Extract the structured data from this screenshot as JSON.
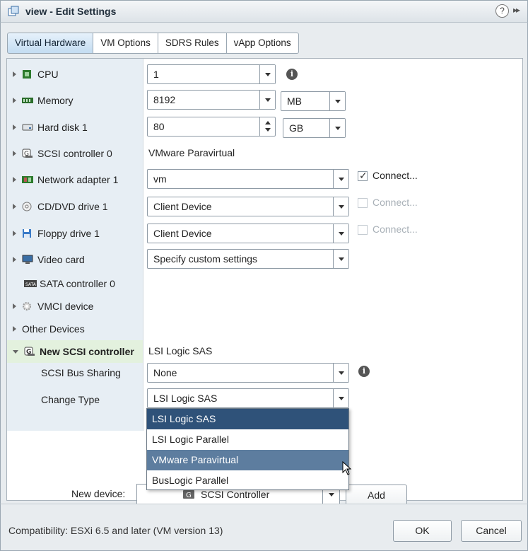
{
  "window": {
    "title": "view - Edit Settings",
    "help": "?",
    "expand": "▸▸"
  },
  "tabs": [
    {
      "label": "Virtual Hardware",
      "active": true
    },
    {
      "label": "VM Options"
    },
    {
      "label": "SDRS Rules"
    },
    {
      "label": "vApp Options"
    }
  ],
  "hardware": {
    "cpu": {
      "label": "CPU",
      "value": "1"
    },
    "memory": {
      "label": "Memory",
      "value": "8192",
      "unit": "MB"
    },
    "hard_disk": {
      "label": "Hard disk 1",
      "value": "80",
      "unit": "GB"
    },
    "scsi0": {
      "label": "SCSI controller 0",
      "value": "VMware Paravirtual"
    },
    "network": {
      "label": "Network adapter 1",
      "value": "vm",
      "connect_label": "Connect...",
      "connected": true
    },
    "cddvd": {
      "label": "CD/DVD drive 1",
      "value": "Client Device",
      "connect_label": "Connect...",
      "connected": false
    },
    "floppy": {
      "label": "Floppy drive 1",
      "value": "Client Device",
      "connect_label": "Connect...",
      "connected": false
    },
    "video": {
      "label": "Video card",
      "value": "Specify custom settings"
    },
    "sata": {
      "label": "SATA controller 0"
    },
    "vmci": {
      "label": "VMCI device"
    },
    "other": {
      "label": "Other Devices"
    },
    "new_scsi": {
      "label": "New SCSI controller",
      "value": "LSI Logic SAS",
      "bus_sharing_label": "SCSI Bus Sharing",
      "bus_sharing_value": "None",
      "change_type_label": "Change Type",
      "change_type_value": "LSI Logic SAS"
    }
  },
  "dropdown": {
    "options": [
      "LSI Logic SAS",
      "LSI Logic Parallel",
      "VMware Paravirtual",
      "BusLogic Parallel"
    ],
    "selected": "LSI Logic SAS",
    "hovered": "VMware Paravirtual"
  },
  "new_device": {
    "label": "New device:",
    "value": "SCSI Controller",
    "add_label": "Add"
  },
  "footer": {
    "compatibility": "Compatibility: ESXi 6.5 and later (VM version 13)",
    "ok_label": "OK",
    "cancel_label": "Cancel"
  },
  "colors": {
    "selected_option": "#2f5279",
    "hovered_option": "#5d7d9f",
    "left_column": "#e7eef4",
    "expanded_row": "#e3f1de"
  }
}
